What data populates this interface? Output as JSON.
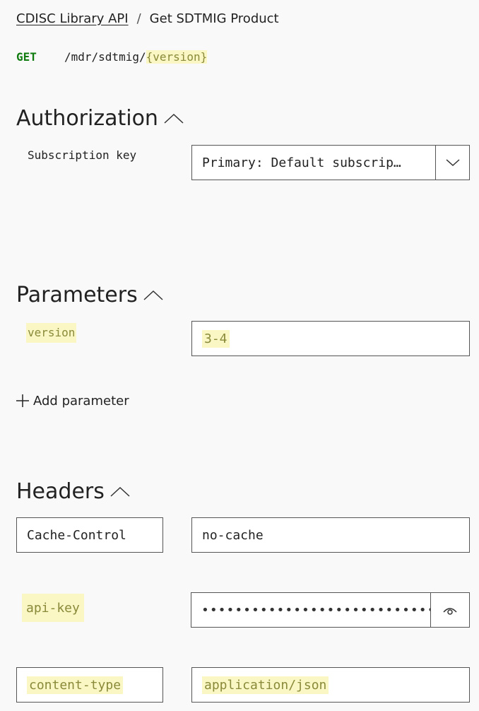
{
  "breadcrumb": {
    "root": "CDISC Library API",
    "separator": "/",
    "current": "Get SDTMIG Product"
  },
  "endpoint": {
    "method": "GET",
    "path_prefix": "/mdr/sdtmig/",
    "path_param": "{version}"
  },
  "authorization": {
    "title": "Authorization",
    "subscription_key_label": "Subscription key",
    "subscription_key_value": "Primary: Default subscrip…"
  },
  "parameters": {
    "title": "Parameters",
    "items": [
      {
        "name": "version",
        "value": "3-4"
      }
    ],
    "add_label": "Add parameter"
  },
  "headers": {
    "title": "Headers",
    "items": [
      {
        "name": "Cache-Control",
        "value": "no-cache"
      },
      {
        "name": "api-key",
        "value": "••••••••••••••••••••••••••••••"
      },
      {
        "name": "content-type",
        "value": "application/json"
      }
    ]
  },
  "icons": {
    "collapse": "chevron-up-icon",
    "dropdown": "chevron-down-icon",
    "reveal": "eye-icon",
    "add": "plus-icon"
  },
  "colors": {
    "method_get": "#107c10",
    "highlight_bg": "#fbf7c4",
    "highlight_text": "#8a8a3a"
  }
}
